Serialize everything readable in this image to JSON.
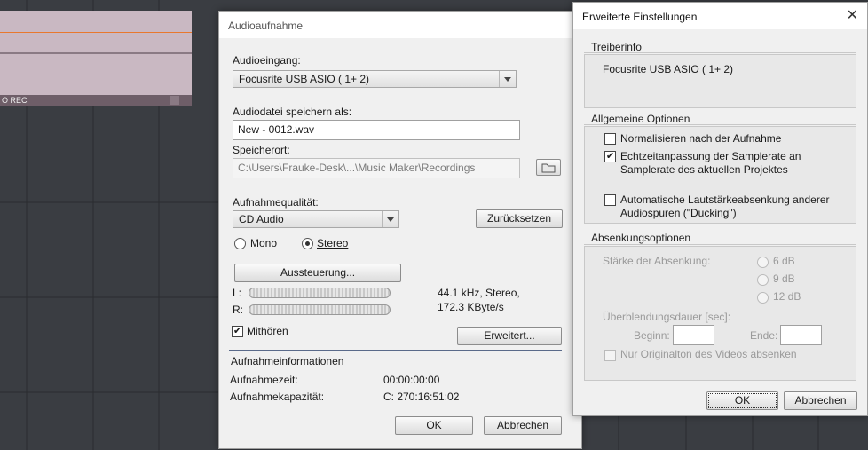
{
  "background": {
    "clip_label": "O REC"
  },
  "audio_dialog": {
    "title": "Audioaufnahme",
    "input_label": "Audioeingang:",
    "input_value": "Focusrite USB ASIO ( 1+ 2)",
    "save_as_label": "Audiodatei speichern als:",
    "save_as_value": "New - 0012.wav",
    "location_label": "Speicherort:",
    "location_value": "C:\\Users\\Frauke-Desk\\...\\Music Maker\\Recordings",
    "quality_label": "Aufnahmequalität:",
    "quality_value": "CD Audio",
    "reset_button": "Zurücksetzen",
    "mono_label": "Mono",
    "stereo_label": "Stereo",
    "selected_channel": "Stereo",
    "level_button": "Aussteuerung...",
    "meter_left_label": "L:",
    "meter_right_label": "R:",
    "format_line1": "44.1 kHz, Stereo,",
    "format_line2": "172.3 KByte/s",
    "monitor_label": "Mithören",
    "monitor_checked": true,
    "advanced_button": "Erweitert...",
    "info_header": "Aufnahmeinformationen",
    "rec_time_label": "Aufnahmezeit:",
    "rec_time_value": "00:00:00:00",
    "capacity_label": "Aufnahmekapazität:",
    "capacity_value": "C: 270:16:51:02",
    "ok_button": "OK",
    "cancel_button": "Abbrechen"
  },
  "advanced_dialog": {
    "title": "Erweiterte Einstellungen",
    "driver_header": "Treiberinfo",
    "driver_value": "Focusrite USB ASIO ( 1+ 2)",
    "general_header": "Allgemeine Optionen",
    "normalize_label": "Normalisieren nach der Aufnahme",
    "normalize_checked": false,
    "samplerate_label_1": "Echtzeitanpassung der Samplerate an",
    "samplerate_label_2": "Samplerate des aktuellen Projektes",
    "samplerate_checked": true,
    "ducking_label_1": "Automatische Lautstärkeabsenkung anderer",
    "ducking_label_2": "Audiospuren (\"Ducking\")",
    "ducking_checked": false,
    "lowering_header": "Absenkungsoptionen",
    "strength_label": "Stärke der Absenkung:",
    "strength_options": [
      "6 dB",
      "9 dB",
      "12 dB"
    ],
    "fade_label": "Überblendungsdauer [sec]:",
    "begin_label": "Beginn:",
    "end_label": "Ende:",
    "begin_value": "",
    "end_value": "",
    "video_label": "Nur Originalton des Videos absenken",
    "ok_button": "OK",
    "cancel_button": "Abbrechen"
  }
}
